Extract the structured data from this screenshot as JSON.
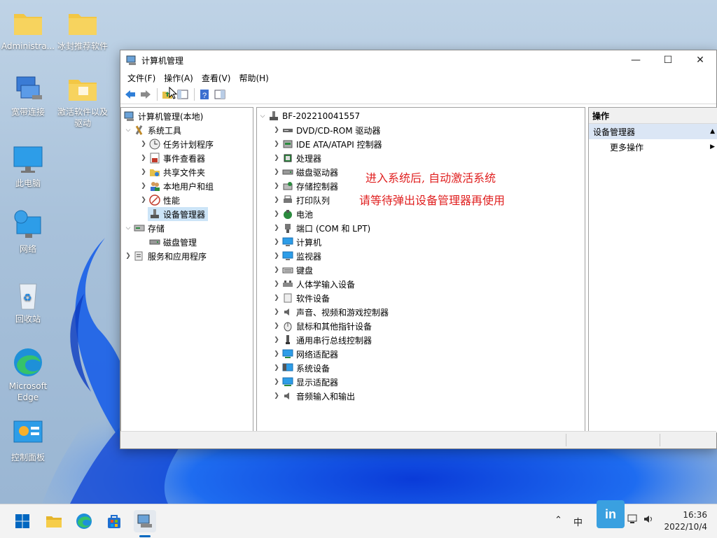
{
  "desktop": {
    "icons": [
      {
        "label": "Administra..."
      },
      {
        "label": "冰封推荐软件"
      },
      {
        "label": "宽带连接"
      },
      {
        "label": "激活软件以及驱动"
      },
      {
        "label": "此电脑"
      },
      {
        "label": "网络"
      },
      {
        "label": "回收站"
      },
      {
        "label": "Microsoft Edge"
      },
      {
        "label": "控制面板"
      }
    ]
  },
  "window": {
    "title": "计算机管理",
    "controls": {
      "minimize": "—",
      "maximize": "☐",
      "close": "✕"
    },
    "menu": [
      "文件(F)",
      "操作(A)",
      "查看(V)",
      "帮助(H)"
    ],
    "left_tree": [
      {
        "label": "计算机管理(本地)"
      },
      {
        "label": "系统工具"
      },
      {
        "label": "任务计划程序"
      },
      {
        "label": "事件查看器"
      },
      {
        "label": "共享文件夹"
      },
      {
        "label": "本地用户和组"
      },
      {
        "label": "性能"
      },
      {
        "label": "设备管理器"
      },
      {
        "label": "存储"
      },
      {
        "label": "磁盘管理"
      },
      {
        "label": "服务和应用程序"
      }
    ],
    "device_tree": {
      "root": "BF-202210041557",
      "items": [
        "DVD/CD-ROM 驱动器",
        "IDE ATA/ATAPI 控制器",
        "处理器",
        "磁盘驱动器",
        "存储控制器",
        "打印队列",
        "电池",
        "端口 (COM 和 LPT)",
        "计算机",
        "监视器",
        "键盘",
        "人体学输入设备",
        "软件设备",
        "声音、视频和游戏控制器",
        "鼠标和其他指针设备",
        "通用串行总线控制器",
        "网络适配器",
        "系统设备",
        "显示适配器",
        "音频输入和输出"
      ]
    },
    "actions": {
      "header": "操作",
      "section": "设备管理器",
      "more": "更多操作"
    }
  },
  "overlay_text": {
    "line1": "进入系统后, 自动激活系统",
    "line2": "请等待弹出设备管理器再使用"
  },
  "taskbar": {
    "tray_ime": "中",
    "time": "16:36",
    "date": "2022/10/4"
  },
  "colors": {
    "overlay_red": "#e02020",
    "selection": "#cce4f7",
    "accent_blue": "#0067c0"
  }
}
